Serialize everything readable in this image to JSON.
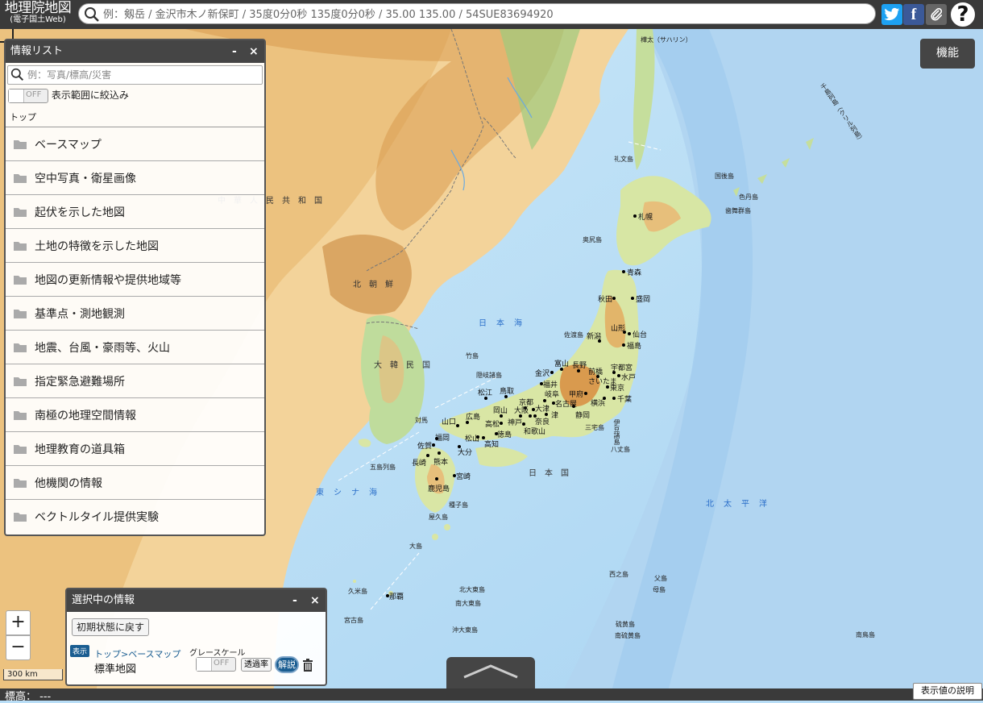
{
  "header": {
    "logo_line1": "地理院地図",
    "logo_line2": "(電子国土Web)",
    "search_placeholder": "例：剱岳 / 金沢市木ノ新保町 / 35度0分0秒 135度0分0秒 / 35.00 135.00 / 54SUE83694920",
    "twitter_label": "t",
    "facebook_label": "f",
    "help_label": "?"
  },
  "info_panel": {
    "title": "情報リスト",
    "minimize": "-",
    "close": "×",
    "search_placeholder": "例：写真/標高/災害",
    "toggle_state": "OFF",
    "filter_label": "表示範囲に絞込み",
    "breadcrumb": "トップ",
    "categories": [
      "ベースマップ",
      "空中写真・衛星画像",
      "起伏を示した地図",
      "土地の特徴を示した地図",
      "地図の更新情報や提供地域等",
      "基準点・測地観測",
      "地震、台風・豪雨等、火山",
      "指定緊急避難場所",
      "南極の地理空間情報",
      "地理教育の道具箱",
      "他機関の情報",
      "ベクトルタイル提供実験"
    ]
  },
  "selected_panel": {
    "title": "選択中の情報",
    "minimize": "-",
    "close": "×",
    "reset_label": "初期状態に戻す",
    "show_badge": "表示",
    "layer_path": "トップ>ベースマップ",
    "layer_name": "標準地図",
    "grayscale_label": "グレースケール",
    "grayscale_state": "OFF",
    "opacity_label": "透過率",
    "desc_label": "解説"
  },
  "map": {
    "function_button": "機能",
    "zoom_in": "+",
    "zoom_out": "−",
    "scale": "300 km",
    "labels": {
      "china": "中華人民共和国",
      "north_korea": "北朝鮮",
      "south_korea": "大韓民国",
      "japan": "日本国",
      "sea_of_japan": "日本海",
      "east_china_sea": "東シナ海",
      "pacific": "北太平洋",
      "sakhalin": "樺太（サハリン）",
      "kuril": "千島列島（クリル列島）"
    },
    "places": [
      "札幌",
      "青森",
      "秋田",
      "盛岡",
      "山形",
      "仙台",
      "新潟",
      "福島",
      "富山",
      "長野",
      "前橋",
      "宇都宮",
      "金沢",
      "さいたま",
      "水戸",
      "福井",
      "甲府",
      "東京",
      "岐阜",
      "千葉",
      "横浜",
      "名古屋",
      "静岡",
      "京都",
      "大津",
      "鳥取",
      "松江",
      "岡山",
      "神戸",
      "大阪",
      "奈良",
      "津",
      "広島",
      "高松",
      "徳島",
      "和歌山",
      "山口",
      "松山",
      "高知",
      "福岡",
      "佐賀",
      "大分",
      "長崎",
      "熊本",
      "宮崎",
      "鹿児島",
      "那覇",
      "竹島",
      "隠岐諸島",
      "佐渡島",
      "礼文島",
      "国後島",
      "色丹島",
      "歯舞群島",
      "奥尻島",
      "対馬",
      "五島列島",
      "種子島",
      "屋久島",
      "八丈島",
      "三宅島",
      "伊豆諸島",
      "南大東島",
      "北大東島",
      "沖大東島",
      "西之島",
      "父島",
      "母島",
      "硫黄島",
      "南硫黄島",
      "南鳥島",
      "久米島",
      "宮古島",
      "大島"
    ]
  },
  "footer": {
    "elevation": "標高：  ---",
    "elevation_help": "表示値の説明"
  }
}
